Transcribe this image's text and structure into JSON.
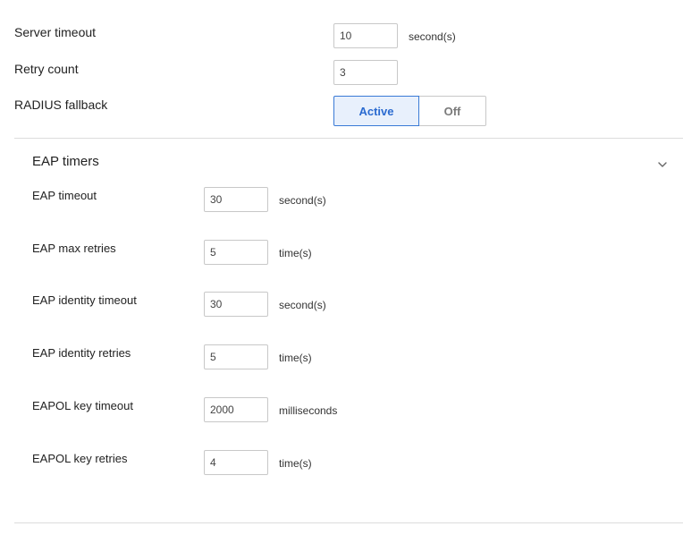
{
  "general": {
    "server_timeout": {
      "label": "Server timeout",
      "value": "10",
      "unit": "second(s)"
    },
    "retry_count": {
      "label": "Retry count",
      "value": "3"
    },
    "radius_fallback": {
      "label": "RADIUS fallback",
      "options": [
        "Active",
        "Off"
      ],
      "selected": "Active"
    }
  },
  "eap_timers": {
    "title": "EAP timers",
    "expanded": true,
    "toggle_icon": "chevron-down-icon",
    "rows": [
      {
        "label": "EAP timeout",
        "value": "30",
        "unit": "second(s)"
      },
      {
        "label": "EAP max retries",
        "value": "5",
        "unit": "time(s)"
      },
      {
        "label": "EAP identity timeout",
        "value": "30",
        "unit": "second(s)"
      },
      {
        "label": "EAP identity retries",
        "value": "5",
        "unit": "time(s)"
      },
      {
        "label": "EAPOL key timeout",
        "value": "2000",
        "unit": "milliseconds"
      },
      {
        "label": "EAPOL key retries",
        "value": "4",
        "unit": "time(s)"
      }
    ]
  },
  "colors": {
    "accent": "#3a7ad6",
    "active_bg": "#e8f0fc",
    "border": "#c8c8c8",
    "divider": "#dcdcdc"
  }
}
